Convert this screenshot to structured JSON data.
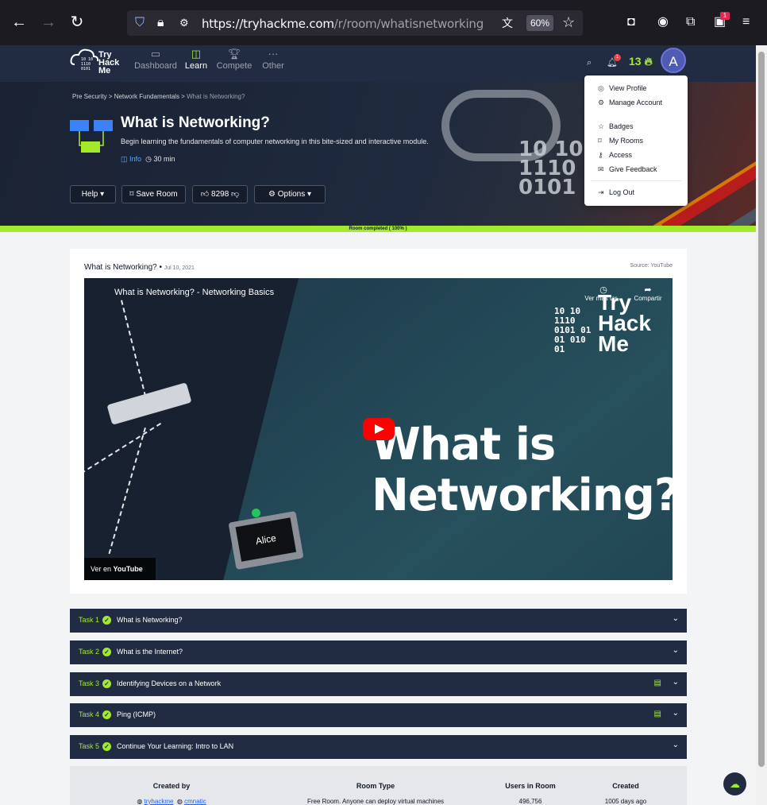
{
  "browser": {
    "url_host": "https://tryhackme.com",
    "url_path": "/r/room/whatisnetworking",
    "zoom": "60%",
    "ext_badge": "1"
  },
  "nav": {
    "logo_words": [
      "Try",
      "Hack",
      "Me"
    ],
    "items": [
      {
        "label": "Dashboard",
        "icon": "monitor-icon"
      },
      {
        "label": "Learn",
        "icon": "book-icon"
      },
      {
        "label": "Compete",
        "icon": "trophy-icon"
      },
      {
        "label": "Other",
        "icon": "more-icon"
      }
    ],
    "notif_count": "1",
    "streak": "13",
    "avatar_letter": "A"
  },
  "dropdown": {
    "items": [
      "View Profile",
      "Manage Account",
      "Badges",
      "My Rooms",
      "Access",
      "Give Feedback",
      "Log Out"
    ]
  },
  "room": {
    "breadcrumbs": [
      "Pre Security",
      "Network Fundamentals",
      "What is Networking?"
    ],
    "title": "What is Networking?",
    "description": "Begin learning the fundamentals of computer networking in this bite-sized and interactive module.",
    "info_label": "Info",
    "duration": "30 min",
    "help_label": "Help",
    "save_label": "Save Room",
    "likes": "8298",
    "options_label": "Options",
    "progress_text": "Room completed ( 100% )",
    "progress_percent": 100
  },
  "video_card": {
    "title": "What is Networking?",
    "date": "Jul 10, 2021",
    "source": "Source: YouTube",
    "video_title": "What is Networking? - Networking Basics",
    "big_text": [
      "What is",
      "Networking?"
    ],
    "watch_later": "Ver más tar...",
    "share": "Compartir",
    "watch_on": "Ver en",
    "youtube": "YouTube",
    "monitor_label": "Alice",
    "logo_words": [
      "Try",
      "Hack",
      "Me"
    ],
    "logo_bin": [
      "10  10",
      "1110",
      "0101  01",
      "01    010",
      "        01"
    ]
  },
  "tasks": [
    {
      "num": "Task 1",
      "label": "What is Networking?",
      "machine": false
    },
    {
      "num": "Task 2",
      "label": "What is the Internet?",
      "machine": false
    },
    {
      "num": "Task 3",
      "label": "Identifying Devices on a Network",
      "machine": true
    },
    {
      "num": "Task 4",
      "label": "Ping (ICMP)",
      "machine": true
    },
    {
      "num": "Task 5",
      "label": "Continue Your Learning: Intro to LAN",
      "machine": false
    }
  ],
  "stats": {
    "created_by_h": "Created by",
    "creators": [
      "tryhackme",
      "cmnatic"
    ],
    "room_type_h": "Room Type",
    "room_type": "Free Room. Anyone can deploy virtual machines",
    "users_h": "Users in Room",
    "users": "496,756",
    "created_h": "Created",
    "created": "1005 days ago"
  },
  "hero_bin": [
    "10  10",
    "1110",
    "0101"
  ],
  "colors": {
    "accent": "#a3ea2a",
    "navy": "#212c42",
    "avatar": "#4f5bb5"
  }
}
